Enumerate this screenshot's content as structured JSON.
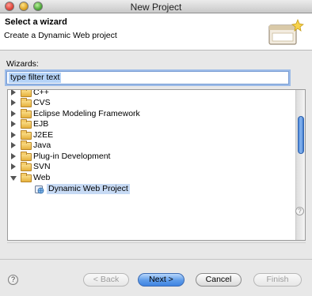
{
  "window": {
    "title": "New Project"
  },
  "banner": {
    "title": "Select a wizard",
    "description": "Create a Dynamic Web project",
    "icon": "wizard-banner-icon"
  },
  "filter": {
    "label": "Wizards:",
    "value": "type filter text"
  },
  "tree": {
    "items": [
      {
        "label": "C++",
        "expanded": false
      },
      {
        "label": "CVS",
        "expanded": false
      },
      {
        "label": "Eclipse Modeling Framework",
        "expanded": false
      },
      {
        "label": "EJB",
        "expanded": false
      },
      {
        "label": "J2EE",
        "expanded": false
      },
      {
        "label": "Java",
        "expanded": false
      },
      {
        "label": "Plug-in Development",
        "expanded": false
      },
      {
        "label": "SVN",
        "expanded": false
      },
      {
        "label": "Web",
        "expanded": true
      }
    ],
    "selected_child": {
      "label": "Dynamic Web Project",
      "icon": "web-project-icon"
    }
  },
  "help": {
    "small_glyph": "?",
    "footer_glyph": "?"
  },
  "buttons": {
    "back": "< Back",
    "next": "Next >",
    "cancel": "Cancel",
    "finish": "Finish"
  }
}
